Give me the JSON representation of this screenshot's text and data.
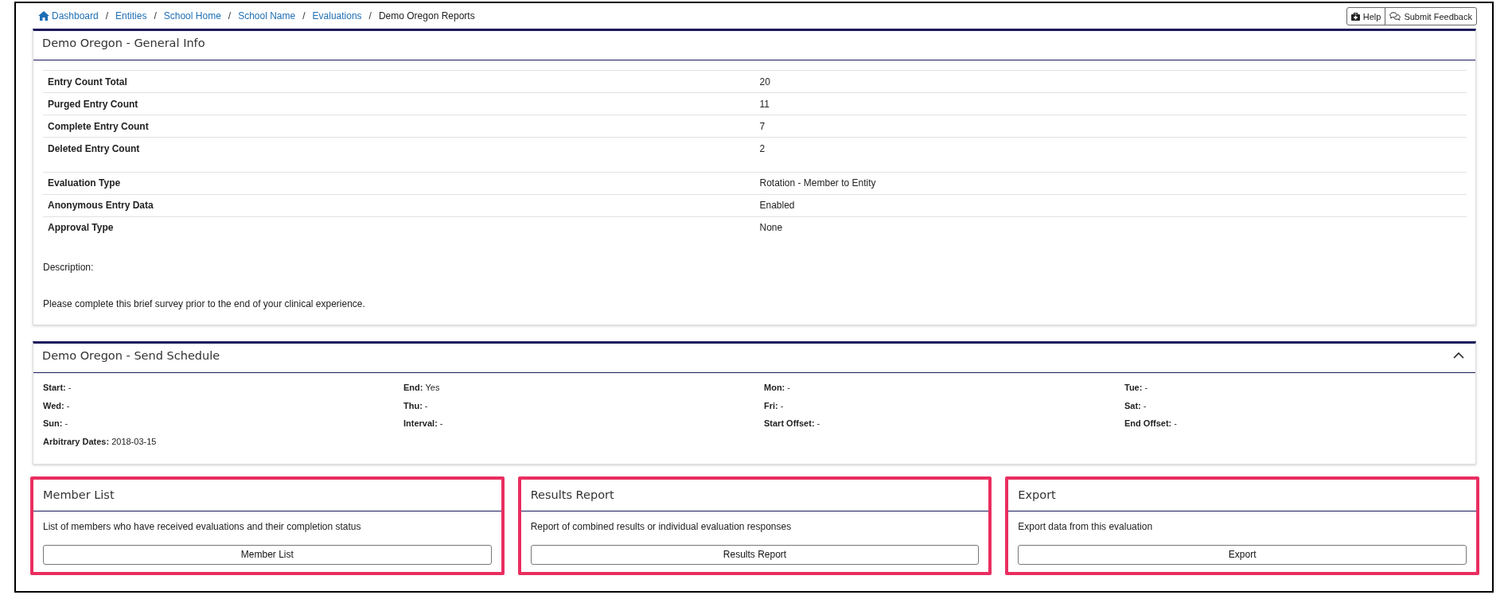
{
  "breadcrumb": {
    "separator": "/",
    "items": [
      {
        "label": "Dashboard",
        "kind": "home"
      },
      {
        "label": "Entities",
        "kind": "link"
      },
      {
        "label": "School Home",
        "kind": "link"
      },
      {
        "label": "School Name",
        "kind": "link"
      },
      {
        "label": "Evaluations",
        "kind": "link"
      },
      {
        "label": "Demo Oregon Reports",
        "kind": "current"
      }
    ]
  },
  "toolbar": [
    {
      "label": "Help",
      "kind": "help"
    },
    {
      "label": "Submit Feedback",
      "kind": "feedback"
    }
  ],
  "general_info": {
    "title": "Demo Oregon - General Info",
    "counts": [
      {
        "label": "Entry Count Total",
        "value": "20"
      },
      {
        "label": "Purged Entry Count",
        "value": "11"
      },
      {
        "label": "Complete Entry Count",
        "value": "7"
      },
      {
        "label": "Deleted Entry Count",
        "value": "2"
      }
    ],
    "settings": [
      {
        "label": "Evaluation Type",
        "value": "Rotation - Member to Entity"
      },
      {
        "label": "Anonymous Entry Data",
        "value": "Enabled"
      },
      {
        "label": "Approval Type",
        "value": "None"
      }
    ],
    "description_label": "Description:",
    "description": "Please complete this brief survey prior to the end of your clinical experience."
  },
  "send_schedule": {
    "title": "Demo Oregon - Send Schedule",
    "expanded": true,
    "fields": [
      {
        "label": "Start:",
        "value": "-"
      },
      {
        "label": "End:",
        "value": "Yes"
      },
      {
        "label": "Mon:",
        "value": "-"
      },
      {
        "label": "Tue:",
        "value": "-"
      },
      {
        "label": "Wed:",
        "value": "-"
      },
      {
        "label": "Thu:",
        "value": "-"
      },
      {
        "label": "Fri:",
        "value": "-"
      },
      {
        "label": "Sat:",
        "value": "-"
      },
      {
        "label": "Sun:",
        "value": "-"
      },
      {
        "label": "Interval:",
        "value": "-"
      },
      {
        "label": "Start Offset:",
        "value": "-"
      },
      {
        "label": "End Offset:",
        "value": "-"
      },
      {
        "label": "Arbitrary Dates:",
        "value": "2018-03-15"
      }
    ]
  },
  "cards": [
    {
      "title": "Member List",
      "description": "List of members who have received evaluations and their completion status",
      "button": "Member List",
      "highlighted": true
    },
    {
      "title": "Results Report",
      "description": "Report of combined results or individual evaluation responses",
      "button": "Results Report",
      "highlighted": true
    },
    {
      "title": "Export",
      "description": "Export data from this evaluation",
      "button": "Export",
      "highlighted": true
    }
  ]
}
